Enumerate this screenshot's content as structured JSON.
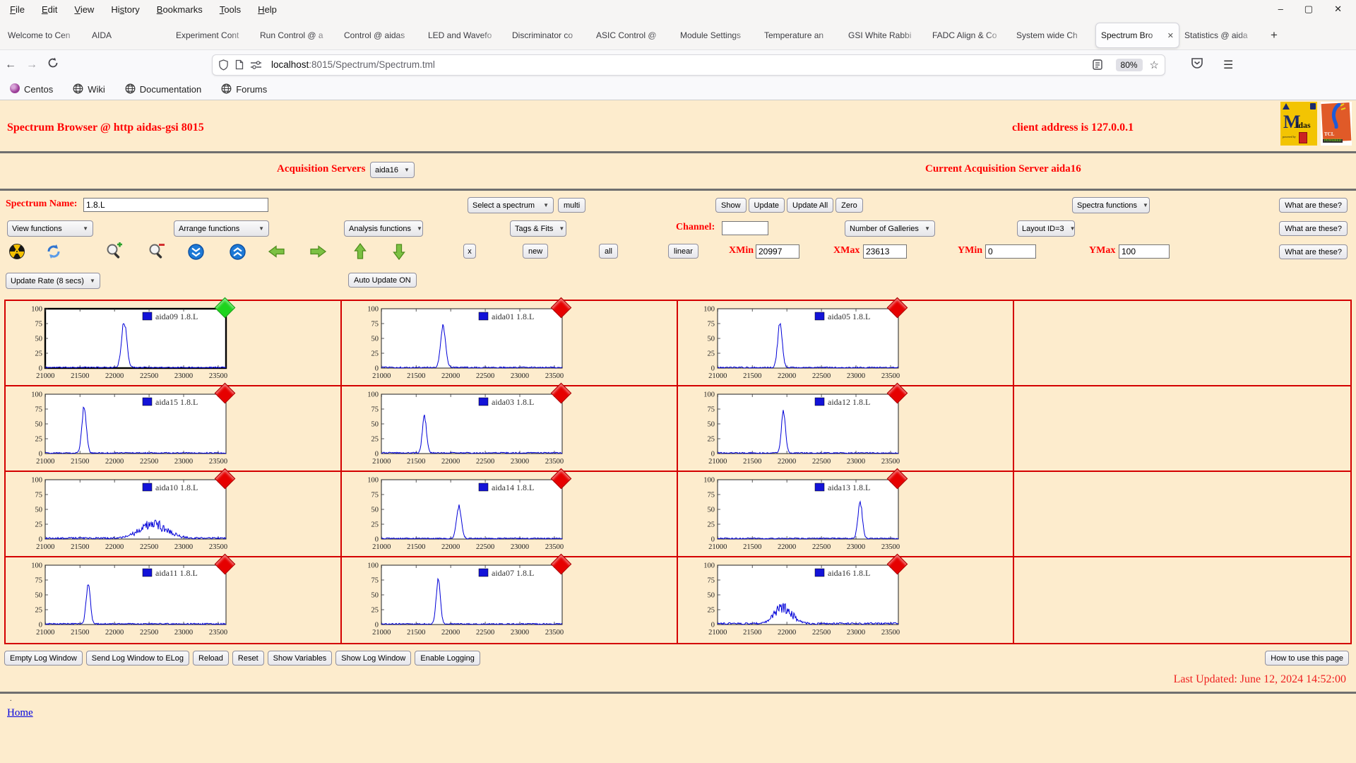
{
  "browser": {
    "menu": [
      {
        "label": "File",
        "accel": 0
      },
      {
        "label": "Edit",
        "accel": 0
      },
      {
        "label": "View",
        "accel": 0
      },
      {
        "label": "History",
        "accel": 2
      },
      {
        "label": "Bookmarks",
        "accel": 0
      },
      {
        "label": "Tools",
        "accel": 0
      },
      {
        "label": "Help",
        "accel": 0
      }
    ],
    "window_controls": [
      "minimize-icon",
      "maximize-icon",
      "close-icon"
    ],
    "tabs": [
      {
        "label": "Welcome to Cen",
        "active": false
      },
      {
        "label": "AIDA",
        "active": false
      },
      {
        "label": "Experiment Cont",
        "active": false
      },
      {
        "label": "Run Control @ a",
        "active": false
      },
      {
        "label": "Control @ aidas",
        "active": false
      },
      {
        "label": "LED and Wavefo",
        "active": false
      },
      {
        "label": "Discriminator co",
        "active": false
      },
      {
        "label": "ASIC Control @",
        "active": false
      },
      {
        "label": "Module Settings",
        "active": false
      },
      {
        "label": "Temperature an",
        "active": false
      },
      {
        "label": "GSI White Rabbi",
        "active": false
      },
      {
        "label": "FADC Align & Co",
        "active": false
      },
      {
        "label": "System wide Ch",
        "active": false
      },
      {
        "label": "Spectrum Bro",
        "active": true
      },
      {
        "label": "Statistics @ aida",
        "active": false
      }
    ],
    "new_tab_label": "+",
    "nav": {
      "url_host": "localhost",
      "url_path": ":8015/Spectrum/Spectrum.tml",
      "zoom_badge": "80%"
    },
    "bookmarks": [
      {
        "label": "Centos",
        "icon": "centos-icon"
      },
      {
        "label": "Wiki",
        "icon": "globe-icon"
      },
      {
        "label": "Documentation",
        "icon": "globe-icon"
      },
      {
        "label": "Forums",
        "icon": "globe-icon"
      }
    ]
  },
  "page": {
    "title": "Spectrum Browser @ http aidas-gsi 8015",
    "client_address": "client address is 127.0.0.1",
    "acquisition_servers_label": "Acquisition Servers",
    "acquisition_server_value": "aida16",
    "current_server_text": "Current Acquisition Server aida16",
    "spectrum_name_label": "Spectrum Name:",
    "spectrum_name_value": "1.8.L",
    "select_spectrum_label": "Select a spectrum",
    "multi_label": "multi",
    "show_label": "Show",
    "update_label": "Update",
    "update_all_label": "Update All",
    "zero_label": "Zero",
    "spectra_functions_label": "Spectra functions",
    "what_are_these_label": "What are these?",
    "view_functions_label": "View functions",
    "arrange_functions_label": "Arrange functions",
    "analysis_functions_label": "Analysis functions",
    "tags_fits_label": "Tags & Fits",
    "channel_label": "Channel:",
    "channel_value": "",
    "number_of_galleries_label": "Number of Galleries",
    "layout_id_label": "Layout ID=3",
    "toolbar_icons": [
      "radiation-icon",
      "refresh-icon",
      "zoom-in-icon",
      "zoom-out-icon",
      "compress-vertical-icon",
      "expand-vertical-icon",
      "pan-left-icon",
      "pan-right-icon",
      "pan-up-icon",
      "pan-down-icon"
    ],
    "x_label": "x",
    "new_label": "new",
    "all_label": "all",
    "linear_label": "linear",
    "xmin_label": "XMin",
    "xmin_value": "20997",
    "xmax_label": "XMax",
    "xmax_value": "23613",
    "ymin_label": "YMin",
    "ymin_value": "0",
    "ymax_label": "YMax",
    "ymax_value": "100",
    "update_rate_label": "Update Rate (8 secs)",
    "auto_update_label": "Auto Update ON",
    "footer_buttons": [
      "Empty Log Window",
      "Send Log Window to ELog",
      "Reload",
      "Reset",
      "Show Variables",
      "Show Log Window",
      "Enable Logging"
    ],
    "how_to_label": "How to use this page",
    "last_updated": "Last Updated: June 12, 2024 14:52:00",
    "dot": ".",
    "home_label": "Home"
  },
  "chart_data": {
    "type": "line",
    "title": "",
    "xlim": [
      20997,
      23613
    ],
    "ylim": [
      0,
      100
    ],
    "xticks": [
      21000,
      21500,
      22000,
      22500,
      23000,
      23500
    ],
    "yticks": [
      0,
      25,
      50,
      75,
      100
    ],
    "line_color": "#0000d8",
    "grid": false,
    "legend_position": "top-right",
    "layout": {
      "rows": 4,
      "cols": 4,
      "plots_per_row": 3
    },
    "plots": [
      {
        "name": "aida09 1.8.L",
        "status_color": "#1ed41e",
        "selected": true,
        "peaks": [
          {
            "center": 22140,
            "height": 78,
            "sigma": 38
          }
        ],
        "noise": 2.2,
        "broad": false
      },
      {
        "name": "aida01 1.8.L",
        "status_color": "#e60000",
        "selected": false,
        "peaks": [
          {
            "center": 21890,
            "height": 72,
            "sigma": 36
          }
        ],
        "noise": 2.2,
        "broad": false
      },
      {
        "name": "aida05 1.8.L",
        "status_color": "#e60000",
        "selected": false,
        "peaks": [
          {
            "center": 21900,
            "height": 75,
            "sigma": 33
          }
        ],
        "noise": 2.0,
        "broad": false
      },
      {
        "name": "aida15 1.8.L",
        "status_color": "#e60000",
        "selected": false,
        "peaks": [
          {
            "center": 21560,
            "height": 80,
            "sigma": 32
          }
        ],
        "noise": 2.0,
        "broad": false
      },
      {
        "name": "aida03 1.8.L",
        "status_color": "#e60000",
        "selected": false,
        "peaks": [
          {
            "center": 21620,
            "height": 62,
            "sigma": 30
          }
        ],
        "noise": 2.2,
        "broad": false
      },
      {
        "name": "aida12 1.8.L",
        "status_color": "#e60000",
        "selected": false,
        "peaks": [
          {
            "center": 21950,
            "height": 72,
            "sigma": 30
          }
        ],
        "noise": 2.0,
        "broad": false
      },
      {
        "name": "aida10 1.8.L",
        "status_color": "#e60000",
        "selected": false,
        "peaks": [
          {
            "center": 22560,
            "height": 24,
            "sigma": 190
          }
        ],
        "noise": 3.0,
        "broad": true
      },
      {
        "name": "aida14 1.8.L",
        "status_color": "#e60000",
        "selected": false,
        "peaks": [
          {
            "center": 22120,
            "height": 55,
            "sigma": 35
          }
        ],
        "noise": 2.0,
        "broad": false
      },
      {
        "name": "aida13 1.8.L",
        "status_color": "#e60000",
        "selected": false,
        "peaks": [
          {
            "center": 23060,
            "height": 62,
            "sigma": 32
          }
        ],
        "noise": 2.0,
        "broad": false
      },
      {
        "name": "aida11 1.8.L",
        "status_color": "#e60000",
        "selected": false,
        "peaks": [
          {
            "center": 21620,
            "height": 70,
            "sigma": 30
          }
        ],
        "noise": 2.2,
        "broad": false
      },
      {
        "name": "aida07 1.8.L",
        "status_color": "#e60000",
        "selected": false,
        "peaks": [
          {
            "center": 21820,
            "height": 76,
            "sigma": 30
          }
        ],
        "noise": 2.0,
        "broad": false
      },
      {
        "name": "aida16 1.8.L",
        "status_color": "#e60000",
        "selected": false,
        "peaks": [
          {
            "center": 21950,
            "height": 28,
            "sigma": 120
          }
        ],
        "noise": 3.2,
        "broad": true
      }
    ]
  }
}
